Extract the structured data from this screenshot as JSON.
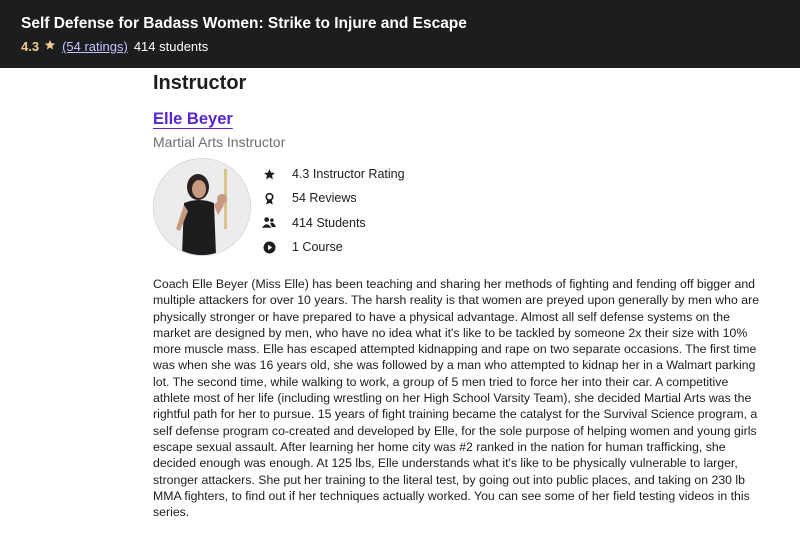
{
  "header": {
    "course_title": "Self Defense for Badass Women: Strike to Injure and Escape",
    "rating": "4.3",
    "ratings_link": "(54 ratings)",
    "students": "414 students",
    "rating_color": "#f3ca8c",
    "link_color": "#c0c4fc",
    "bar_color": "#1c1d1f"
  },
  "instructor": {
    "section_title": "Instructor",
    "name": "Elle Beyer",
    "job_title": "Martial Arts Instructor",
    "name_color": "#5624d0",
    "stats": [
      {
        "icon": "star-icon",
        "text": "4.3 Instructor Rating"
      },
      {
        "icon": "award-icon",
        "text": "54 Reviews"
      },
      {
        "icon": "people-icon",
        "text": "414 Students"
      },
      {
        "icon": "play-circle-icon",
        "text": "1 Course"
      }
    ],
    "bio": "Coach Elle Beyer (Miss Elle) has been teaching and sharing her methods of fighting and fending off bigger and multiple attackers for over 10 years.  The harsh reality is that women are preyed upon generally by men who are physically stronger or have prepared to have a physical advantage. Almost all self defense systems on the market are designed by men, who have no idea what it's like to be tackled by someone 2x their size with 10% more muscle mass.  Elle has escaped attempted kidnapping and rape on two separate occasions.  The first time was when she was 16 years old, she was followed by a man who attempted to kidnap her in a Walmart parking lot.  The second time, while walking to work, a group of 5 men tried to force her into their car.  A competitive athlete most of her life (including wrestling on her High School Varsity Team), she decided Martial Arts was the rightful path for her to pursue.  15 years of fight training became the catalyst for the Survival Science program, a self defense program co-created and developed by Elle, for the sole purpose of helping women and young girls escape sexual assault.  After learning her home city was #2 ranked in the nation for human trafficking, she decided enough was enough.  At 125 lbs, Elle understands what it's like to be physically vulnerable to larger, stronger attackers.  She put her training to the literal test, by going out into public places, and taking on 230 lb MMA fighters, to find out if her techniques actually worked.  You can see some of her field testing videos in this series."
  }
}
